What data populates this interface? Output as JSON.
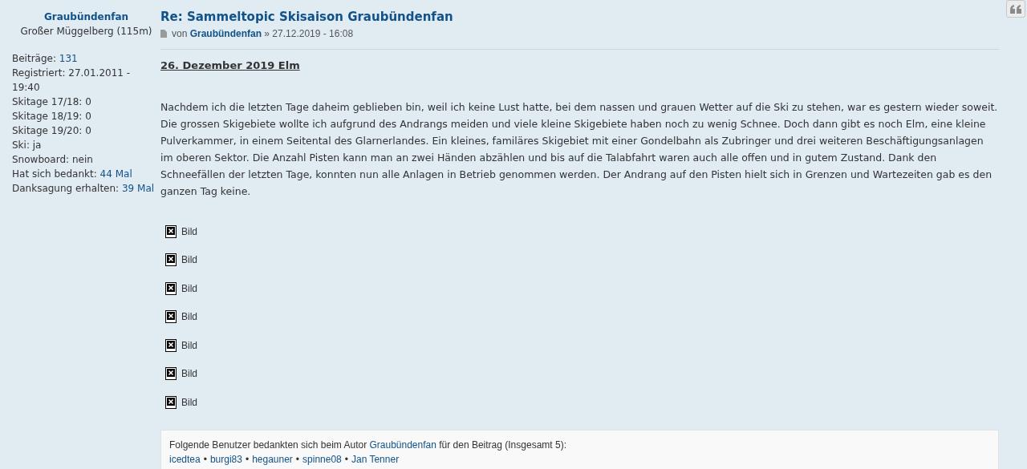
{
  "profile": {
    "username": "Graubündenfan",
    "rank": "Großer Müggelberg (115m)",
    "fields": [
      {
        "label": "Beiträge:",
        "value": "131",
        "kind": "link"
      },
      {
        "label": "Registriert:",
        "value": "27.01.2011 - 19:40",
        "kind": "text"
      },
      {
        "label": "Skitage 17/18:",
        "value": "0",
        "kind": "text"
      },
      {
        "label": "Skitage 18/19:",
        "value": "0",
        "kind": "text"
      },
      {
        "label": "Skitage 19/20:",
        "value": "0",
        "kind": "text"
      },
      {
        "label": "Ski:",
        "value": "ja",
        "kind": "text"
      },
      {
        "label": "Snowboard:",
        "value": "nein",
        "kind": "text"
      },
      {
        "label": "Hat sich bedankt:",
        "value": "44 Mal",
        "kind": "link"
      },
      {
        "label": "Danksagung erhalten:",
        "value": "39 Mal",
        "kind": "link"
      }
    ]
  },
  "post": {
    "title": "Re: Sammeltopic Skisaison Graubündenfan",
    "by": "von",
    "author": "Graubündenfan",
    "date": "» 27.12.2019 - 16:08",
    "heading": "26. Dezember 2019 Elm",
    "body": "Nachdem ich die letzten Tage daheim geblieben bin, weil ich keine Lust hatte, bei dem nassen und grauen Wetter auf die Ski zu stehen, war es gestern wieder soweit. Die grossen Skigebiete wollte ich aufgrund des Andrangs meiden und viele kleine Skigebiete haben noch zu wenig Schnee. Doch dann gibt es noch Elm, eine kleine Pulverkammer, in einem Seitental des Glarnerlandes. Ein kleines, familäres Skigebiet mit einer Gondelbahn als Zubringer und drei weiteren Beschäftigungsanlagen im oberen Sektor. Die Anzahl Pisten kann man an zwei Händen abzählen und bis auf die Talabfahrt waren auch alle offen und in gutem Zustand. Dank den Schneefällen der letzten Tage, konnten nun alle Anlagen in Betrieb genommen werden. Der Andrang auf den Pisten hielt sich in Grenzen und Wartezeiten gab es den ganzen Tag keine.",
    "images": [
      "Bild",
      "Bild",
      "Bild",
      "Bild",
      "Bild",
      "Bild",
      "Bild"
    ]
  },
  "thanks": {
    "before": "Folgende Benutzer bedankten sich beim Autor",
    "author": "Graubündenfan",
    "after": "für den Beitrag (Insgesamt 5):",
    "users": [
      "icedtea",
      "burgi83",
      "hegauner",
      "spinne08",
      "Jan Tenner"
    ],
    "separator": "•"
  }
}
